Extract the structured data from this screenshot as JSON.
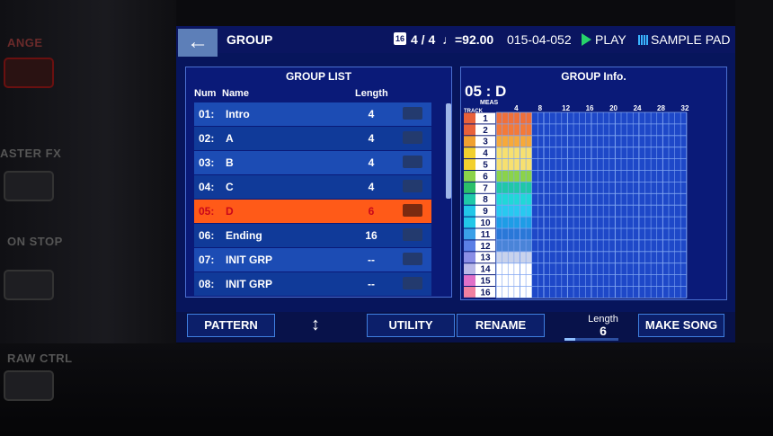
{
  "header": {
    "title": "GROUP",
    "beat_box": "16",
    "time_signature": "4 / 4",
    "tempo": "♩=92.00",
    "position": "015-04-052",
    "status": "PLAY",
    "mode": "SAMPLE PAD"
  },
  "hardware_labels": [
    "ANGE",
    "ASTER FX",
    "ON STOP",
    "RAW CTRL"
  ],
  "group_list": {
    "title": "GROUP LIST",
    "col_num": "Num",
    "col_name": "Name",
    "col_length": "Length",
    "rows": [
      {
        "num": "01:",
        "name": "Intro",
        "length": "4",
        "selected": false
      },
      {
        "num": "02:",
        "name": "A",
        "length": "4",
        "selected": false
      },
      {
        "num": "03:",
        "name": "B",
        "length": "4",
        "selected": false
      },
      {
        "num": "04:",
        "name": "C",
        "length": "4",
        "selected": false
      },
      {
        "num": "05:",
        "name": "D",
        "length": "6",
        "selected": true
      },
      {
        "num": "06:",
        "name": "Ending",
        "length": "16",
        "selected": false
      },
      {
        "num": "07:",
        "name": "INIT GRP",
        "length": "--",
        "selected": false
      },
      {
        "num": "08:",
        "name": "INIT GRP",
        "length": "--",
        "selected": false
      }
    ]
  },
  "group_info": {
    "title": "GROUP Info.",
    "group_name": "05 : D",
    "meas_label": "MEAS",
    "track_label": "TRACK",
    "measure_ticks": [
      "4",
      "8",
      "12",
      "16",
      "20",
      "24",
      "28",
      "32"
    ],
    "tracks": [
      "1",
      "2",
      "3",
      "4",
      "5",
      "6",
      "7",
      "8",
      "9",
      "10",
      "11",
      "12",
      "13",
      "14",
      "15",
      "16"
    ],
    "track_colors": [
      "#e8613a",
      "#e8613a",
      "#f0a030",
      "#f2d02e",
      "#f2d02e",
      "#8bd34a",
      "#2bbf6a",
      "#1fc8a8",
      "#22c7e8",
      "#22c7e8",
      "#3aa0e8",
      "#5b7fe6",
      "#8a8ee6",
      "#b9b9e8",
      "#e070c8",
      "#f080a0"
    ],
    "fill_colors": [
      "#f0703a",
      "#f47a38",
      "#f7a93a",
      "#f7e070",
      "#f7e070",
      "#8bd34a",
      "#1fc8a8",
      "#20d8d8",
      "#28c9f0",
      "#1e9de6",
      "#2a78d8",
      "#4a84d8",
      "#c8d2ec",
      "#ffffff",
      "#ffffff",
      "#ffffff"
    ],
    "filled_measures": 6
  },
  "bottom_bar": {
    "pattern": "PATTERN",
    "updown": "↕",
    "utility": "UTILITY",
    "rename": "RENAME",
    "length_label": "Length",
    "length_value": "6",
    "make_song": "MAKE SONG"
  }
}
